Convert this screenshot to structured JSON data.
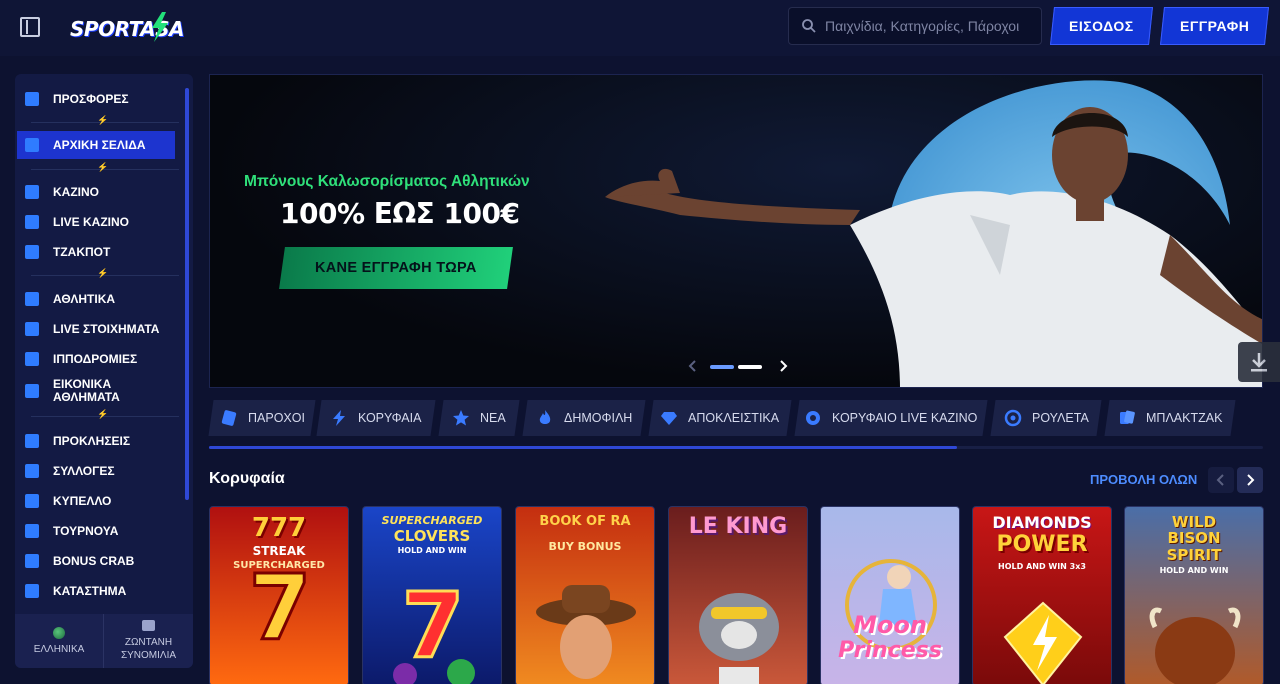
{
  "header": {
    "logo_text": "SPORTASA",
    "search_placeholder": "Παιχνίδια, Κατηγορίες, Πάροχοι",
    "login_label": "ΕΙΣΟΔΟΣ",
    "register_label": "ΕΓΓΡΑΦΗ"
  },
  "sidebar": {
    "items": [
      {
        "label": "ΠΡΟΣΦΟΡΕΣ",
        "icon": "gift-icon"
      },
      {
        "label": "ΑΡΧΙΚΗ ΣΕΛΙΔΑ",
        "icon": "home-icon",
        "active": true
      },
      {
        "label": "ΚΑΖΙΝΟ",
        "icon": "slot-machine-icon"
      },
      {
        "label": "LIVE ΚΑΖΙΝΟ",
        "icon": "live-casino-icon"
      },
      {
        "label": "ΤΖΑΚΠΟΤ",
        "icon": "clover-icon"
      },
      {
        "label": "ΑΘΛΗΤΙΚΑ",
        "icon": "soccer-ball-icon"
      },
      {
        "label": "LIVE ΣΤΟΙΧΗΜΑΤΑ",
        "icon": "live-badge-icon"
      },
      {
        "label": "ΙΠΠΟΔΡΟΜΙΕΣ",
        "icon": "horse-icon"
      },
      {
        "label": "ΕΙΚΟΝΙΚΑ ΑΘΛΗΜΑΤΑ",
        "icon": "virtual-sports-icon"
      },
      {
        "label": "ΠΡΟΚΛΗΣΕΙΣ",
        "icon": "medal-icon"
      },
      {
        "label": "ΣΥΛΛΟΓΕΣ",
        "icon": "collection-icon"
      },
      {
        "label": "ΚΥΠΕΛΛΟ",
        "icon": "trophy-icon"
      },
      {
        "label": "ΤΟΥΡΝΟΥΑ",
        "icon": "checkered-flag-icon"
      },
      {
        "label": "BONUS CRAB",
        "icon": "crab-claw-icon"
      },
      {
        "label": "ΚΑΤΑΣΤΗΜΑ",
        "icon": "store-icon"
      }
    ],
    "footer": {
      "language_label": "ΕΛΛΗΝΙΚΑ",
      "chat_label": "ΖΩΝΤΑΝΗ ΣΥΝΟΜΙΛΙΑ"
    }
  },
  "banner": {
    "subtitle": "Μπόνους Καλωσορίσματος Αθλητικών",
    "title": "100% ΕΩΣ 100€",
    "cta_label": "ΚΑΝΕ ΕΓΓΡΑΦΗ ΤΩΡΑ",
    "slides_total": 2,
    "active_slide": 2
  },
  "tabs": [
    {
      "label": "ΠΑΡΟΧΟΙ",
      "icon": "providers-icon"
    },
    {
      "label": "ΚΟΡΥΦΑΙΑ",
      "icon": "lightning-icon"
    },
    {
      "label": "ΝΕΑ",
      "icon": "star-icon"
    },
    {
      "label": "ΔΗΜΟΦΙΛΗ",
      "icon": "fire-icon"
    },
    {
      "label": "ΑΠΟΚΛΕΙΣΤΙΚΑ",
      "icon": "diamond-icon"
    },
    {
      "label": "ΚΟΡΥΦΑΙΟ LIVE ΚΑΖΙΝΟ",
      "icon": "chips-icon"
    },
    {
      "label": "ΡΟΥΛΕΤΑ",
      "icon": "roulette-icon"
    },
    {
      "label": "ΜΠΛΑΚΤΖΑΚ",
      "icon": "cards-icon"
    }
  ],
  "section": {
    "title": "Κορυφαία",
    "view_all_label": "ΠΡΟΒΟΛΗ ΟΛΩΝ"
  },
  "games": [
    {
      "title_line1": "777",
      "title_line2": "STREAK",
      "title_line3": "SUPERCHARGED"
    },
    {
      "title_line1": "SUPERCHARGED",
      "title_line2": "CLOVERS",
      "title_line3": "HOLD AND WIN"
    },
    {
      "title_line1": "BOOK OF RA",
      "title_line2": "",
      "title_line3": "BUY BONUS"
    },
    {
      "title_line1": "LE KING",
      "title_line2": "",
      "title_line3": ""
    },
    {
      "title_line1": "Moon",
      "title_line2": "Princess",
      "title_line3": ""
    },
    {
      "title_line1": "DIAMONDS",
      "title_line2": "POWER",
      "title_line3": "HOLD AND WIN 3x3"
    },
    {
      "title_line1": "WILD",
      "title_line2": "BISON",
      "title_line3": "SPIRIT",
      "title_line4": "HOLD AND WIN"
    }
  ],
  "colors": {
    "accent_blue": "#1236d6",
    "cta_green": "#20d07a",
    "link_blue": "#4d8cff",
    "background": "#0d1230"
  }
}
